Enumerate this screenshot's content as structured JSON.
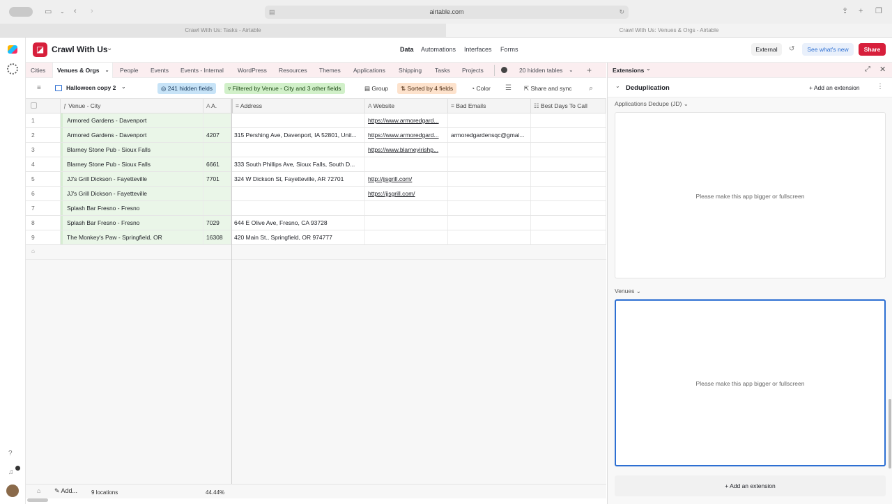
{
  "browser": {
    "url": "airtable.com",
    "tabs": [
      "Crawl With Us: Tasks - Airtable",
      "Crawl With Us: Venues & Orgs - Airtable"
    ]
  },
  "app": {
    "name": "Crawl With Us",
    "nav": [
      "Data",
      "Automations",
      "Interfaces",
      "Forms"
    ],
    "external_label": "External",
    "whats_new_label": "See what's new",
    "share_label": "Share",
    "colors": {
      "brand": "#d71f3b",
      "tabbar_bg": "#fbeef0",
      "primary_col_bg": "#eaf6e8",
      "accent_blue": "#2d6fd2"
    }
  },
  "tables": {
    "tabs": [
      "Cities",
      "Venues & Orgs",
      "People",
      "Events",
      "Events - Internal",
      "WordPress",
      "Resources",
      "Themes",
      "Applications",
      "Shipping",
      "Tasks",
      "Projects"
    ],
    "hidden_tables": "20 hidden tables"
  },
  "toolbar": {
    "view_name": "Halloween copy 2",
    "hidden_fields": "241 hidden fields",
    "filter": "Filtered by Venue - City and 3 other fields",
    "group": "Group",
    "sort": "Sorted by 4 fields",
    "color": "Color",
    "share_sync": "Share and sync"
  },
  "grid": {
    "columns": [
      "Venue - City",
      "A.",
      "Address",
      "Website",
      "Bad Emails",
      "Best Days To Call"
    ],
    "rows": [
      {
        "n": "1",
        "venue": "Armored Gardens - Davenport",
        "a": "",
        "address": "",
        "website": "https://www.armoredgard...",
        "bad_email": "",
        "best": ""
      },
      {
        "n": "2",
        "venue": "Armored Gardens - Davenport",
        "a": "4207",
        "address": "315 Pershing Ave, Davenport, IA 52801, Unit...",
        "website": "https://www.armoredgard...",
        "bad_email": "armoredgardensqc@gmai...",
        "best": ""
      },
      {
        "n": "3",
        "venue": "Blarney Stone Pub - Sioux Falls",
        "a": "",
        "address": "",
        "website": "https://www.blarneyirishp...",
        "bad_email": "",
        "best": ""
      },
      {
        "n": "4",
        "venue": "Blarney Stone Pub - Sioux Falls",
        "a": "6661",
        "address": "333 South Phillips Ave, Sioux Falls, South D...",
        "website": "",
        "bad_email": "",
        "best": ""
      },
      {
        "n": "5",
        "venue": "JJ's Grill Dickson - Fayetteville",
        "a": "7701",
        "address": "324 W Dickson St, Fayetteville, AR 72701",
        "website": "http://jjsgrill.com/",
        "bad_email": "",
        "best": ""
      },
      {
        "n": "6",
        "venue": "JJ's Grill Dickson - Fayetteville",
        "a": "",
        "address": "",
        "website": "https://jjsgrill.com/",
        "bad_email": "",
        "best": ""
      },
      {
        "n": "7",
        "venue": "Splash Bar Fresno - Fresno",
        "a": "",
        "address": "",
        "website": "",
        "bad_email": "",
        "best": ""
      },
      {
        "n": "8",
        "venue": "Splash Bar Fresno - Fresno",
        "a": "7029",
        "address": "644 E Olive Ave, Fresno, CA 93728",
        "website": "",
        "bad_email": "",
        "best": ""
      },
      {
        "n": "9",
        "venue": "The Monkey's Paw - Springfield, OR",
        "a": "16308",
        "address": "420 Main St., Springfield, OR 974777",
        "website": "",
        "bad_email": "",
        "best": ""
      }
    ],
    "footer_add": "Add...",
    "footer_count": "9 locations",
    "footer_pct": "44.44%"
  },
  "extensions": {
    "header": "Extensions",
    "section_title": "Deduplication",
    "add_extension_top": "Add an extension",
    "app1_title": "Applications Dedupe (JD)",
    "app1_msg": "Please make this app bigger or fullscreen",
    "app2_title": "Venues",
    "app2_msg": "Please make this app bigger or fullscreen",
    "add_extension_bottom": "Add an extension"
  }
}
